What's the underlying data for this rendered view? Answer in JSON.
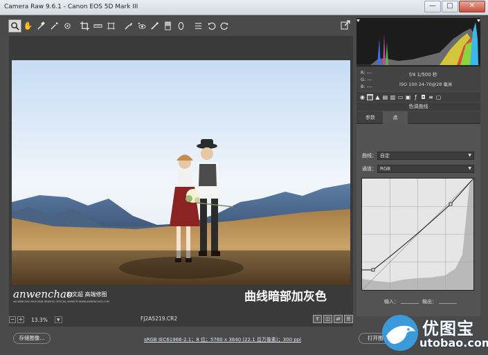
{
  "window": {
    "title": "Camera Raw 9.6.1  -  Canon EOS 5D Mark III",
    "minimize": "—",
    "maximize": "□",
    "close": "✕"
  },
  "toolbar": {
    "tools": [
      "zoom",
      "hand",
      "white-balance",
      "color-sampler",
      "targeted-adjust",
      "crop",
      "straighten",
      "transform",
      "spot-removal",
      "red-eye",
      "adjustment-brush",
      "graduated-filter",
      "radial-filter",
      "presets",
      "rotate-left",
      "rotate-right"
    ]
  },
  "viewer": {
    "watermark_logo": "anwenchao",
    "watermark_cn": "安文超 高端修图",
    "watermark_sub": "AN WENCHAO HIGH-END GRAPHIC OFFICIAL WEBSITE:WWW.ANWENCHAO.COM",
    "caption": "曲线暗部加灰色"
  },
  "zoombar": {
    "minus": "−",
    "plus": "+",
    "zoom": "13.3%",
    "filename": "FJ2A5219.CR2",
    "view_y": "Y",
    "view_split": "◫",
    "view_swap": "⇄",
    "view_settings": "☰"
  },
  "readout": {
    "r": "R:   ---",
    "g": "G:   ---",
    "b": "B:   ---",
    "aperture_shutter": "f/4   1/500 秒",
    "iso_lens": "ISO 100   24-70@28 毫米"
  },
  "panel": {
    "title": "色调曲线",
    "tabs": [
      "参数",
      "点"
    ],
    "active_tab": 1,
    "curve_label": "曲线：",
    "curve_value": "自定",
    "channel_label": "通道：",
    "channel_value": "RGB",
    "input_label": "输入：",
    "output_label": "输出："
  },
  "footer": {
    "save_label": "存储图像...",
    "workflow": "sRGB IEC61966-2.1；8 位；5760 x 3840 (22.1 百万像素)；300 ppi",
    "open_label": "打开图像"
  },
  "brand": {
    "cn": "优图宝",
    "en": "utobao.com"
  },
  "colors": {
    "accent": "#3b9ad9",
    "panel_bg": "#535353",
    "histogram_bg": "#1c1c1c"
  }
}
